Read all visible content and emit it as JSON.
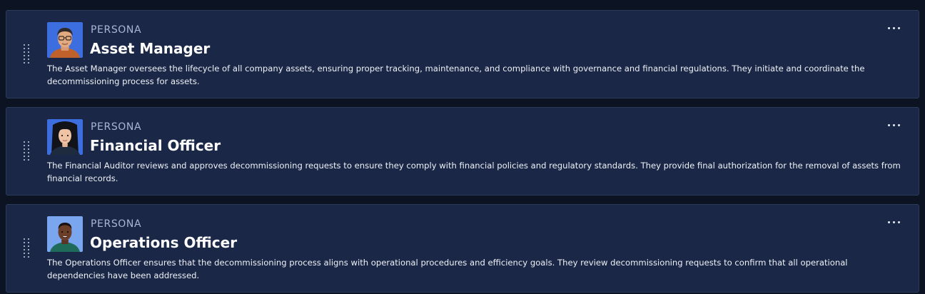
{
  "personas": [
    {
      "eyebrow": "PERSONA",
      "name": "Asset Manager",
      "description": "The Asset Manager oversees the lifecycle of all company assets, ensuring proper tracking, maintenance, and compliance with governance and financial regulations. They initiate and coordinate the decommissioning process for assets.",
      "avatar_icon": "avatar-older-man-glasses"
    },
    {
      "eyebrow": "PERSONA",
      "name": "Financial Officer",
      "description": "The Financial Auditor reviews and approves decommissioning requests to ensure they comply with financial policies and regulatory standards. They provide final authorization for the removal of assets from financial records.",
      "avatar_icon": "avatar-woman-black-hair"
    },
    {
      "eyebrow": "PERSONA",
      "name": "Operations Officer",
      "description": "The Operations Officer ensures that the decommissioning process aligns with operational procedures and efficiency goals. They review decommissioning requests to confirm that all operational dependencies have been addressed.",
      "avatar_icon": "avatar-young-man"
    }
  ],
  "icons": {
    "drag": "drag-handle-icon",
    "more": "more-horizontal-icon"
  },
  "colors": {
    "page_bg": "#0c1322",
    "card_bg": "#1a2746",
    "card_border": "#2c3a5c",
    "eyebrow": "#aab6d6",
    "title": "#ffffff"
  }
}
